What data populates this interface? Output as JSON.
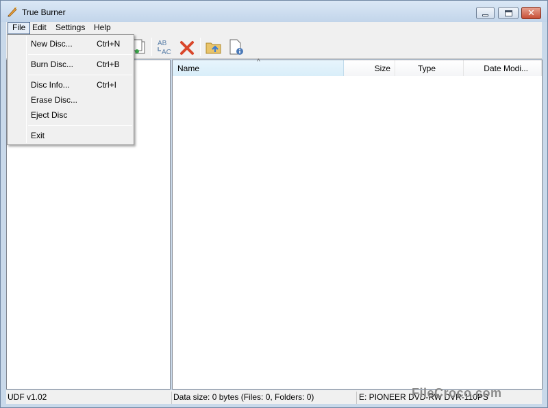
{
  "window": {
    "title": "True Burner"
  },
  "menubar": {
    "items": [
      {
        "label": "File"
      },
      {
        "label": "Edit"
      },
      {
        "label": "Settings"
      },
      {
        "label": "Help"
      }
    ]
  },
  "file_menu": {
    "items": [
      {
        "label": "New Disc...",
        "shortcut": "Ctrl+N"
      },
      {
        "label": "Burn Disc...",
        "shortcut": "Ctrl+B"
      },
      {
        "label": "Disc Info...",
        "shortcut": "Ctrl+I"
      },
      {
        "label": "Erase Disc...",
        "shortcut": ""
      },
      {
        "label": "Eject Disc",
        "shortcut": ""
      },
      {
        "label": "Exit",
        "shortcut": ""
      }
    ]
  },
  "toolbar": {
    "icons": [
      "copy-file-icon",
      "rename-icon",
      "delete-icon",
      "folder-up-icon",
      "properties-icon"
    ],
    "rename_glyph_top": "AB",
    "rename_glyph_bottom": "AC"
  },
  "file_list": {
    "columns": [
      {
        "label": "Name"
      },
      {
        "label": "Size"
      },
      {
        "label": "Type"
      },
      {
        "label": "Date Modi..."
      }
    ],
    "sort_indicator": "^",
    "rows": []
  },
  "statusbar": {
    "format": "UDF v1.02",
    "data_size": "Data size: 0 bytes (Files: 0, Folders: 0)",
    "drive": "E: PIONEER DVD-RW DVR-110PS"
  },
  "watermark": {
    "text": "FileCroco.com"
  },
  "colors": {
    "title_bg": "#c9d9ea",
    "close_button": "#c74d35",
    "delete_x": "#d9472b",
    "sorted_header": "#dcf0fb"
  }
}
